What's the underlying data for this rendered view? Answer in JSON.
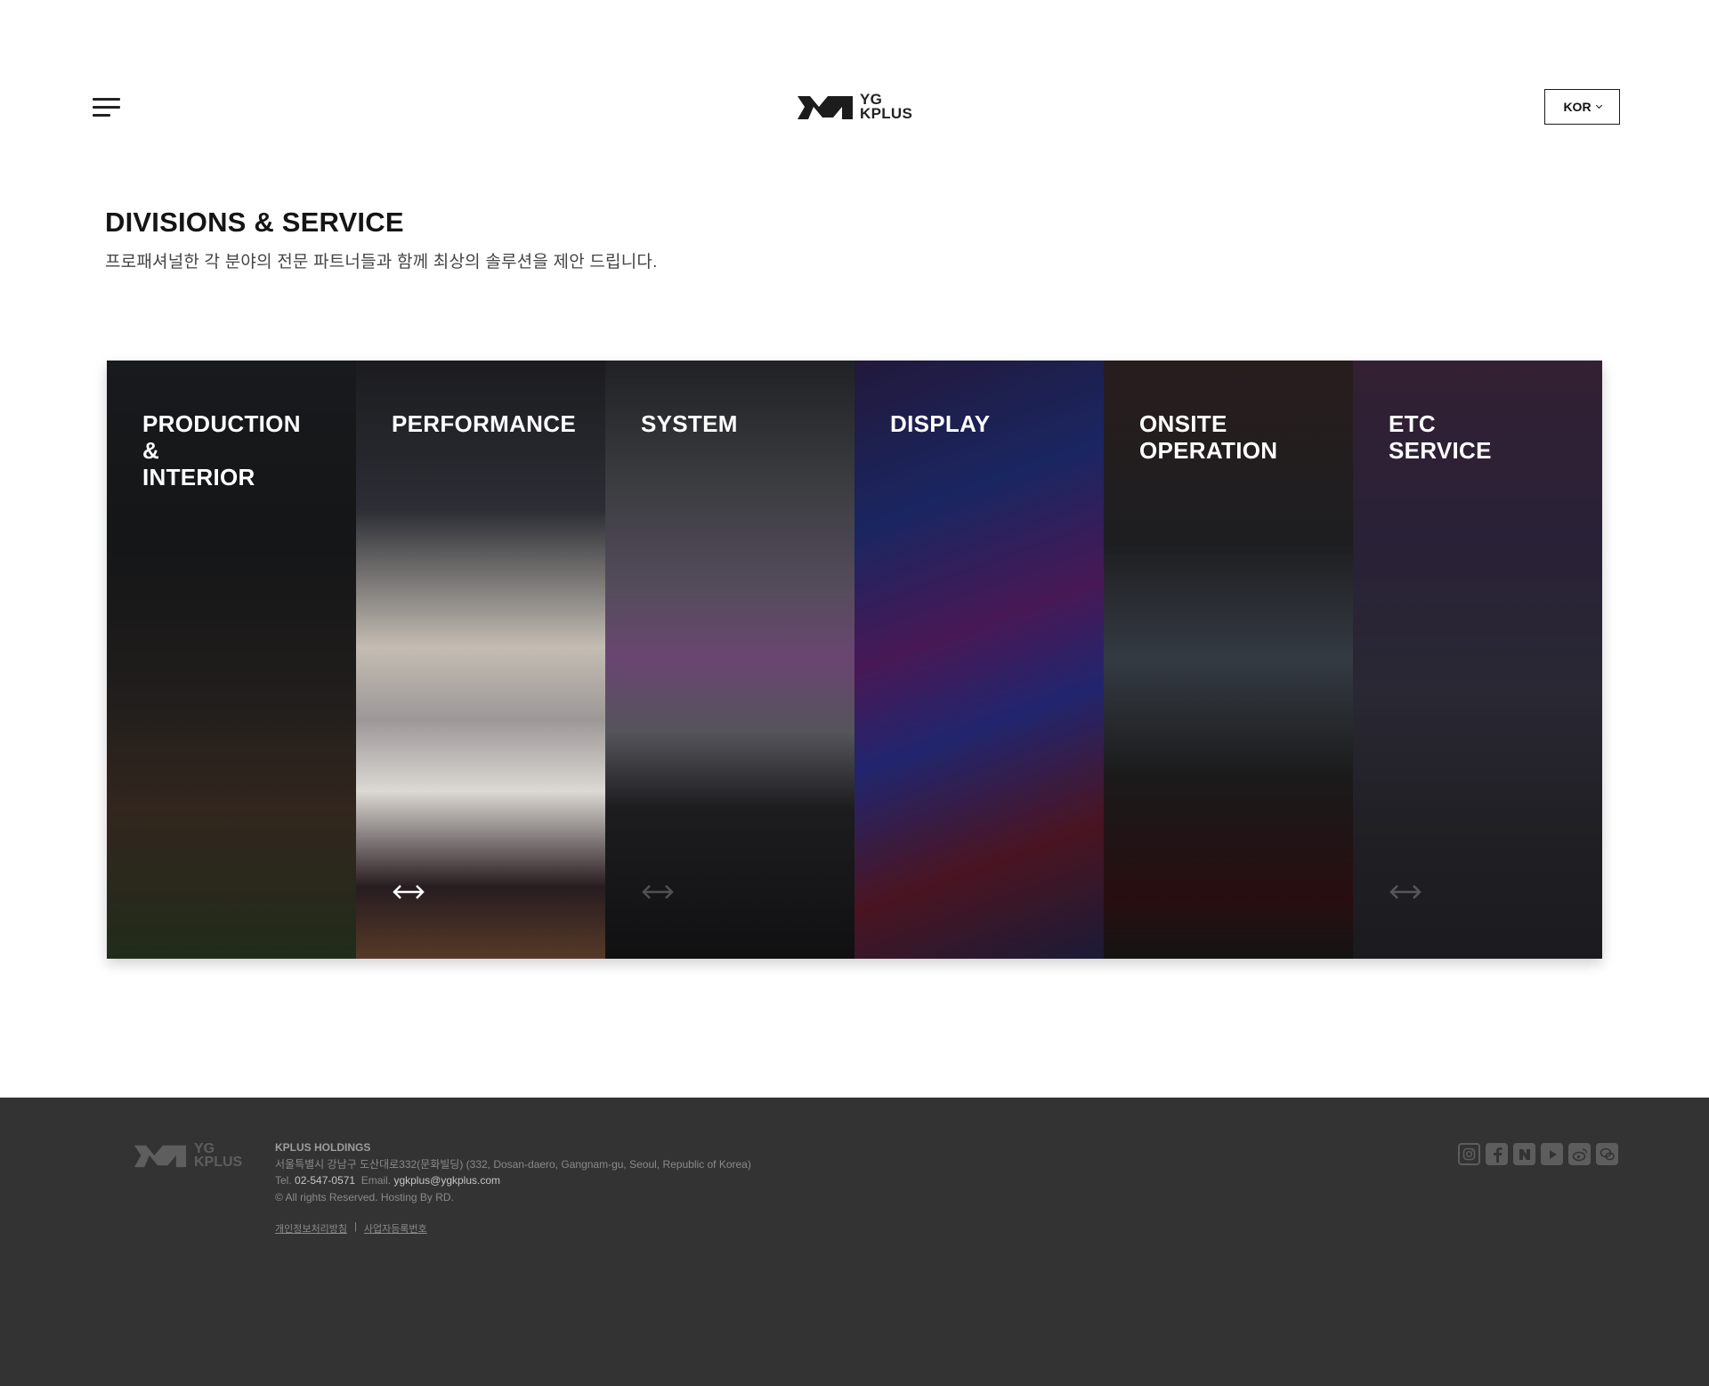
{
  "header": {
    "logo_line1": "YG",
    "logo_line2": "KPLUS",
    "language": "KOR"
  },
  "section": {
    "title": "DIVISIONS & SERVICE",
    "subtitle": "프로패셔널한 각 분야의 전문 파트너들과 함께 최상의 솔루션을 제안 드립니다."
  },
  "divisions": [
    {
      "label": "PRODUCTION\n&\nINTERIOR",
      "active": false
    },
    {
      "label": "PERFORMANCE",
      "active": true
    },
    {
      "label": "SYSTEM",
      "active": false
    },
    {
      "label": "DISPLAY",
      "active": false
    },
    {
      "label": "ONSITE\nOPERATION",
      "active": false
    },
    {
      "label": "ETC\nSERVICE",
      "active": false
    }
  ],
  "footer": {
    "logo_line1": "YG",
    "logo_line2": "KPLUS",
    "company": "KPLUS HOLDINGS",
    "address": "서울특별시 강남구 도산대로332(문화빌딩) (332, Dosan-daero, Gangnam-gu, Seoul, Republic of Korea)",
    "tel_label": "Tel.",
    "tel": "02-547-0571",
    "email_label": "Email.",
    "email": "ygkplus@ygkplus.com",
    "copyright": "© All rights Reserved. Hosting By RD.",
    "link_privacy": "개인정보처리방침",
    "link_separator": "|",
    "link_business": "사업자등록번호",
    "social_icons": [
      "instagram-icon",
      "facebook-icon",
      "naver-icon",
      "youtube-icon",
      "weibo-icon",
      "wechat-icon"
    ]
  }
}
